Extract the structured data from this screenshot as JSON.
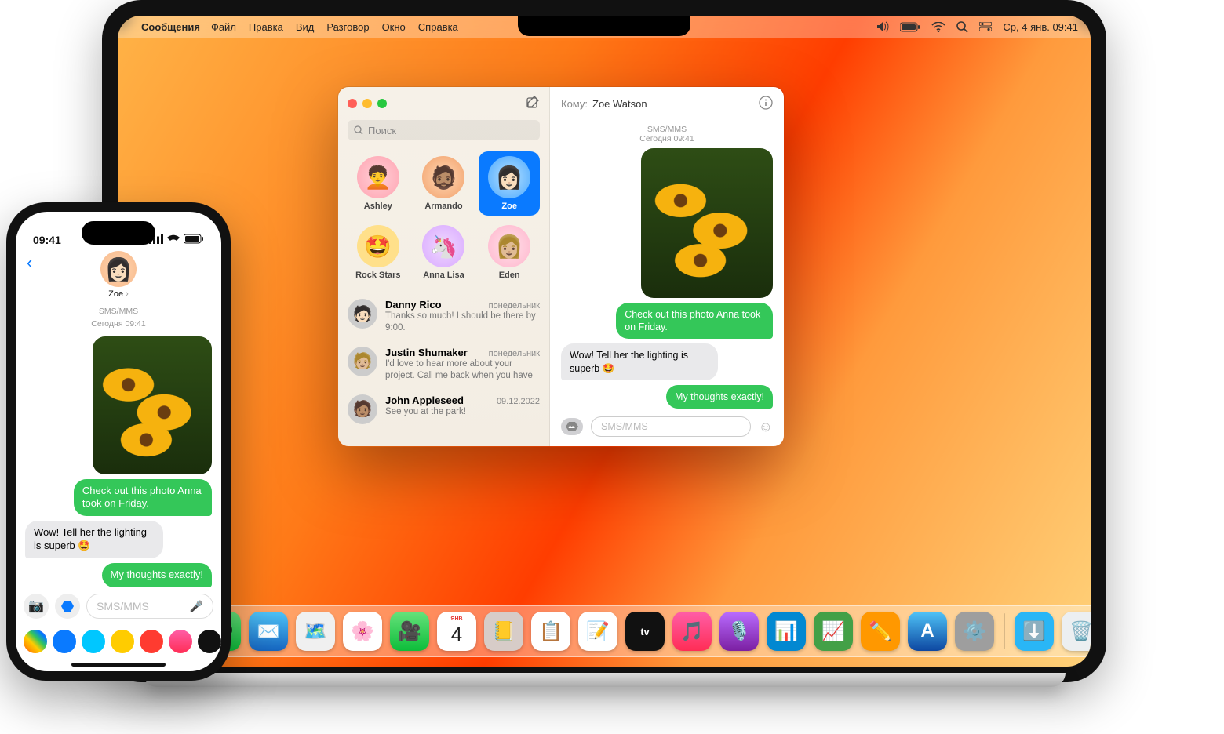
{
  "mac": {
    "menubar": {
      "app": "Сообщения",
      "items": [
        "Файл",
        "Правка",
        "Вид",
        "Разговор",
        "Окно",
        "Справка"
      ],
      "clock": "Ср, 4 янв.  09:41"
    },
    "dock": {
      "calendar_month": "Янв",
      "calendar_day": "4"
    },
    "window": {
      "search_placeholder": "Поиск",
      "pins": [
        {
          "name": "Ashley"
        },
        {
          "name": "Armando"
        },
        {
          "name": "Zoe",
          "selected": true
        },
        {
          "name": "Rock Stars"
        },
        {
          "name": "Anna Lisa"
        },
        {
          "name": "Eden"
        }
      ],
      "conversations": [
        {
          "name": "Danny Rico",
          "time": "понедельник",
          "preview": "Thanks so much! I should be there by 9:00."
        },
        {
          "name": "Justin Shumaker",
          "time": "понедельник",
          "preview": "I'd love to hear more about your project. Call me back when you have a chance!"
        },
        {
          "name": "John Appleseed",
          "time": "09.12.2022",
          "preview": "See you at the park!"
        }
      ],
      "chat": {
        "to_label": "Кому:",
        "to_name": "Zoe Watson",
        "stamp_type": "SMS/MMS",
        "stamp_time": "Сегодня 09:41",
        "msg_out1": "Check out this photo Anna took on Friday.",
        "msg_in1": "Wow! Tell her the lighting is superb 🤩",
        "msg_out2": "My thoughts exactly!",
        "input_placeholder": "SMS/MMS"
      }
    }
  },
  "phone": {
    "status_time": "09:41",
    "contact_name": "Zoe",
    "stamp_type": "SMS/MMS",
    "stamp_time": "Сегодня 09:41",
    "msg_out1": "Check out this photo Anna took on Friday.",
    "msg_in1": "Wow! Tell her the lighting is superb 🤩",
    "msg_out2": "My thoughts exactly!",
    "input_placeholder": "SMS/MMS"
  }
}
